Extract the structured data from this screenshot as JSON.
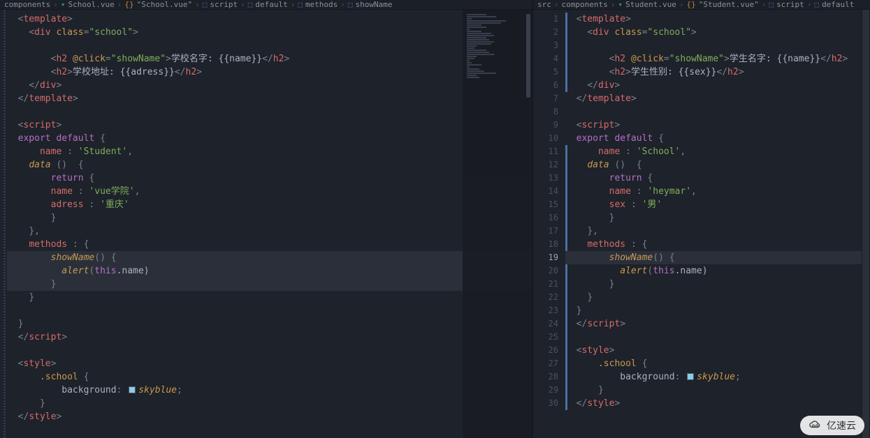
{
  "left": {
    "breadcrumbs": [
      "components",
      "School.vue",
      "\"School.vue\"",
      "script",
      "default",
      "methods",
      "showName"
    ],
    "code": {
      "template_open": "template",
      "div_line": {
        "tag": "div",
        "attr": "class",
        "val": "\"school\""
      },
      "h2a": {
        "tag": "h2",
        "attr": "@click",
        "val": "\"showName\"",
        "text": "学校名字: {{name}}"
      },
      "h2b": {
        "tag": "h2",
        "text": "学校地址: {{adress}}"
      },
      "script_open": "script",
      "export": "export",
      "default": "default",
      "brace": "{",
      "name_key": "name",
      "name_val": "'Student'",
      "data_key": "data",
      "paren": "()",
      "brace2": "{",
      "return": "return",
      "brace3": "{",
      "inner_name": "name",
      "inner_name_val": "'vue学院'",
      "adress": "adress",
      "adress_val": "'重庆'",
      "methods": "methods",
      "fn": "showName",
      "fnparen": "()",
      "alert": "alert",
      "this": "this",
      "dotname": ".name)",
      "style_open": "style",
      "sel": ".school",
      "cssprop": "background",
      "cssval": "skyblue"
    }
  },
  "right": {
    "breadcrumbs": [
      "src",
      "components",
      "Student.vue",
      "\"Student.vue\"",
      "script",
      "default"
    ],
    "code": {
      "template_open": "template",
      "div_line": {
        "tag": "div",
        "attr": "class",
        "val": "\"school\""
      },
      "h2a": {
        "tag": "h2",
        "attr": "@click",
        "val": "\"showName\"",
        "text": "学生名字: {{name}}"
      },
      "h2b": {
        "tag": "h2",
        "text": "学生性别: {{sex}}"
      },
      "script_open": "script",
      "export": "export",
      "default": "default",
      "brace": "{",
      "name_key": "name",
      "name_val": "'School'",
      "data_key": "data",
      "paren": "()",
      "brace2": "{",
      "return": "return",
      "brace3": "{",
      "inner_name": "name",
      "inner_name_val": "'heymar'",
      "sex": "sex",
      "sex_val": "'男'",
      "methods": "methods",
      "fn": "showName",
      "fnparen": "()",
      "alert": "alert",
      "this": "this",
      "dotname": ".name)",
      "style_open": "style",
      "sel": ".school",
      "cssprop": "background",
      "cssval": "skyblue"
    },
    "line_count": 30
  },
  "watermark": "亿速云"
}
